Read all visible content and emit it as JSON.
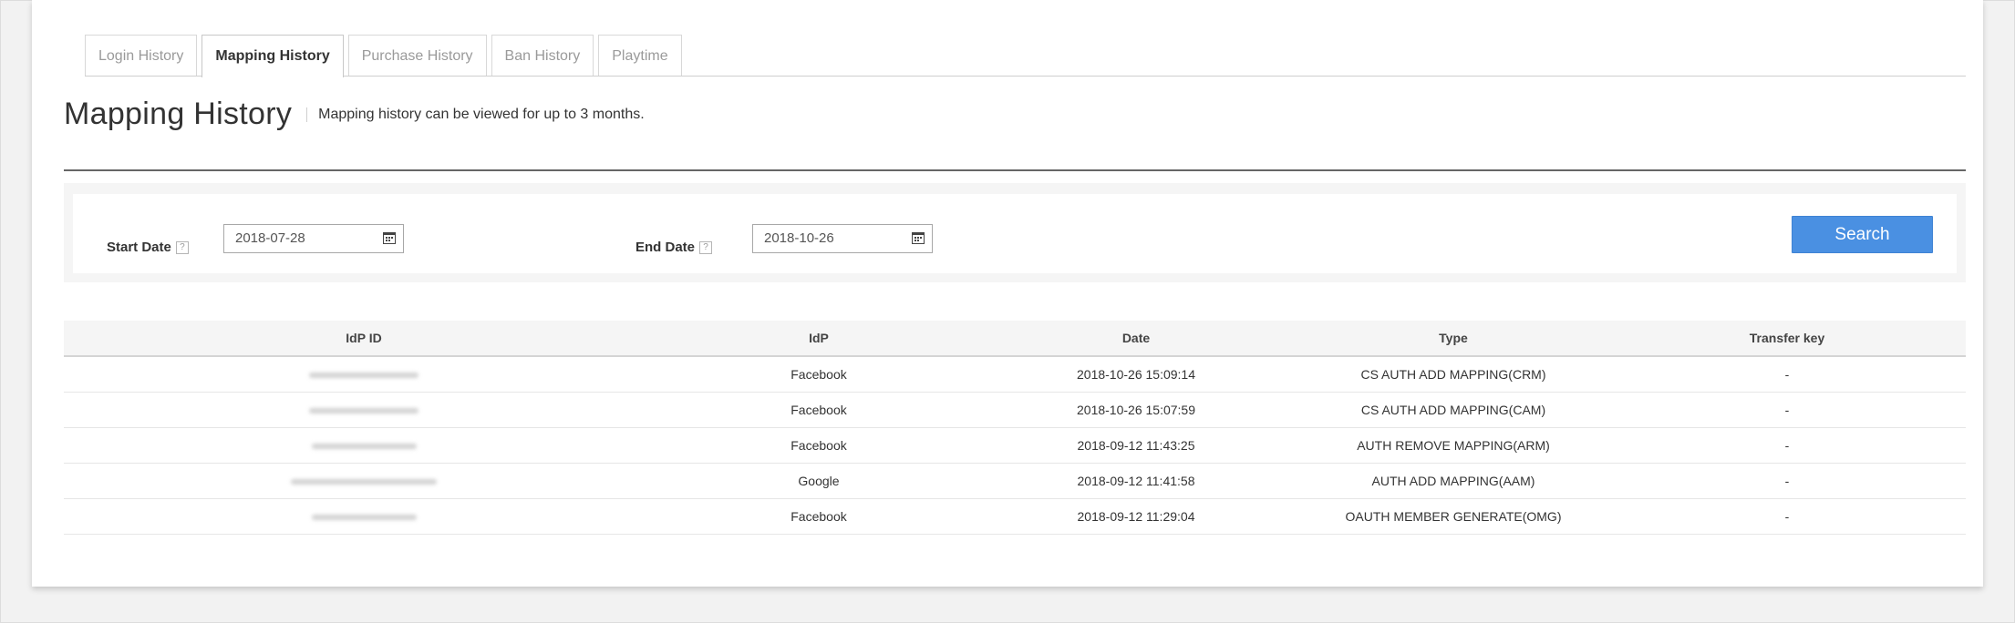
{
  "tabs": [
    {
      "label": "Login History",
      "active": false
    },
    {
      "label": "Mapping History",
      "active": true
    },
    {
      "label": "Purchase History",
      "active": false
    },
    {
      "label": "Ban History",
      "active": false
    },
    {
      "label": "Playtime",
      "active": false
    }
  ],
  "page": {
    "title": "Mapping History",
    "subtitle": "Mapping history can be viewed for up to 3 months."
  },
  "search": {
    "start_label": "Start Date",
    "start_value": "2018-07-28",
    "end_label": "End Date",
    "end_value": "2018-10-26",
    "help_glyph": "?",
    "button_label": "Search"
  },
  "table": {
    "columns": [
      "IdP ID",
      "IdP",
      "Date",
      "Type",
      "Transfer key"
    ],
    "rows": [
      {
        "idp": "Facebook",
        "date": "2018-10-26 15:09:14",
        "type": "CS AUTH ADD MAPPING(CRM)",
        "transfer_key": "-"
      },
      {
        "idp": "Facebook",
        "date": "2018-10-26 15:07:59",
        "type": "CS AUTH ADD MAPPING(CAM)",
        "transfer_key": "-"
      },
      {
        "idp": "Facebook",
        "date": "2018-09-12 11:43:25",
        "type": "AUTH REMOVE MAPPING(ARM)",
        "transfer_key": "-"
      },
      {
        "idp": "Google",
        "date": "2018-09-12 11:41:58",
        "type": "AUTH ADD MAPPING(AAM)",
        "transfer_key": "-"
      },
      {
        "idp": "Facebook",
        "date": "2018-09-12 11:29:04",
        "type": "OAUTH MEMBER GENERATE(OMG)",
        "transfer_key": "-"
      }
    ]
  },
  "colors": {
    "accent": "#4a90e2",
    "panel_bg": "#ffffff",
    "page_bg": "#f2f2f2"
  }
}
